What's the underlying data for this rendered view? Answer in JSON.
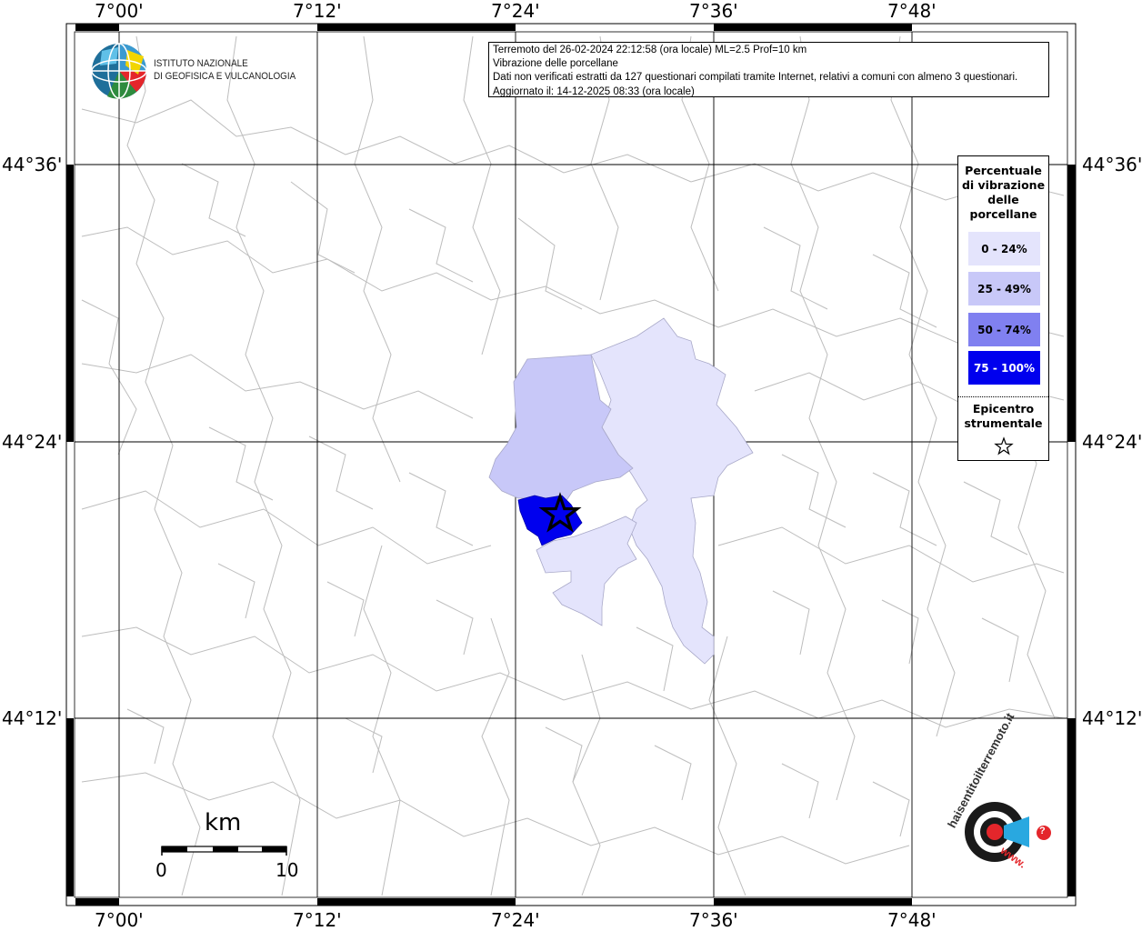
{
  "map": {
    "top_lon_labels": [
      "7°00'",
      "7°12'",
      "7°24'",
      "7°36'",
      "7°48'"
    ],
    "bottom_lon_labels": [
      "7°00'",
      "7°12'",
      "7°24'",
      "7°36'",
      "7°48'"
    ],
    "left_lat_labels": [
      "44°36'",
      "44°24'",
      "44°12'"
    ],
    "right_lat_labels": [
      "44°36'",
      "44°24'",
      "44°12'"
    ],
    "colors": {
      "class_0_24": "#e4e4fc",
      "class_25_49": "#c8c8f8",
      "class_50_74": "#8080f0",
      "class_75_100": "#0000ee",
      "boundaries": "#bdbdbd"
    }
  },
  "logo": {
    "line1": "ISTITUTO NAZIONALE",
    "line2": "DI GEOFISICA E VULCANOLOGIA",
    "icon": "ingv-globe-logo"
  },
  "info": {
    "line1": "Terremoto del 26-02-2024 22:12:58 (ora locale) ML=2.5 Prof=10 km",
    "line2": "Vibrazione delle porcellane",
    "line3": "Dati non verificati estratti da 127 questionari compilati tramite Internet, relativi a comuni con almeno 3 questionari.",
    "line4": "Aggiornato il: 14-12-2025 08:33 (ora locale)"
  },
  "legend": {
    "title_lines": [
      "Percentuale",
      "di vibrazione",
      "delle",
      "porcellane"
    ],
    "items": [
      {
        "label": "0 - 24%",
        "color": "#e4e4fc",
        "text_color": "#000000"
      },
      {
        "label": "25 - 49%",
        "color": "#c8c8f8",
        "text_color": "#000000"
      },
      {
        "label": "50 - 74%",
        "color": "#8080f0",
        "text_color": "#000000"
      },
      {
        "label": "75 - 100%",
        "color": "#0000ee",
        "text_color": "#ffffff"
      }
    ],
    "epicenter_lines": [
      "Epicentro",
      "strumentale"
    ],
    "epicenter_icon": "star-icon"
  },
  "scale_bar": {
    "unit": "km",
    "start": "0",
    "end": "10"
  },
  "footer_logo": {
    "text": "haisentitoilterremoto.it",
    "www": "www.",
    "question": "?",
    "icon": "haisentitoilterremoto-logo"
  }
}
